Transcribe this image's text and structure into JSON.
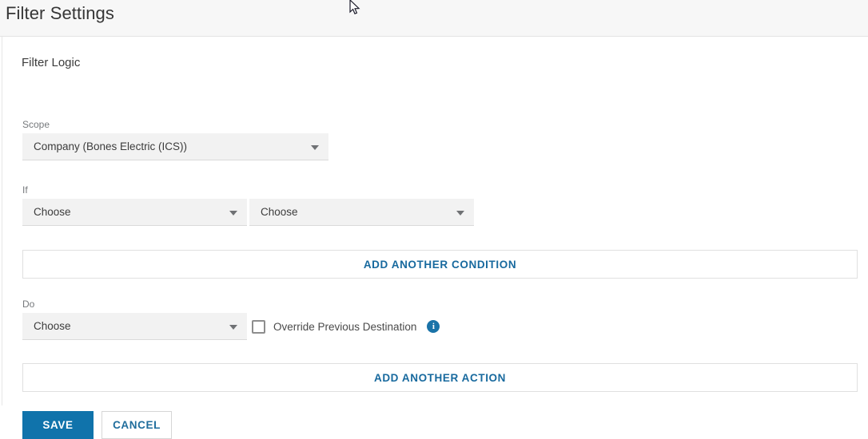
{
  "header": {
    "title": "Filter Settings"
  },
  "form": {
    "section_title": "Filter Logic",
    "scope": {
      "label": "Scope",
      "value": "Company (Bones Electric (ICS))"
    },
    "if": {
      "label": "If",
      "condition_field": "Choose",
      "condition_operator": "Choose"
    },
    "add_condition_label": "ADD ANOTHER CONDITION",
    "do": {
      "label": "Do",
      "action": "Choose",
      "override_label": "Override Previous Destination",
      "override_checked": false,
      "info_glyph": "i"
    },
    "add_action_label": "ADD ANOTHER ACTION",
    "buttons": {
      "save": "SAVE",
      "cancel": "CANCEL"
    }
  },
  "colors": {
    "accent": "#1073ab",
    "link": "#17699e",
    "header_bg": "#f7f7f7",
    "field_bg": "#f2f2f2"
  }
}
